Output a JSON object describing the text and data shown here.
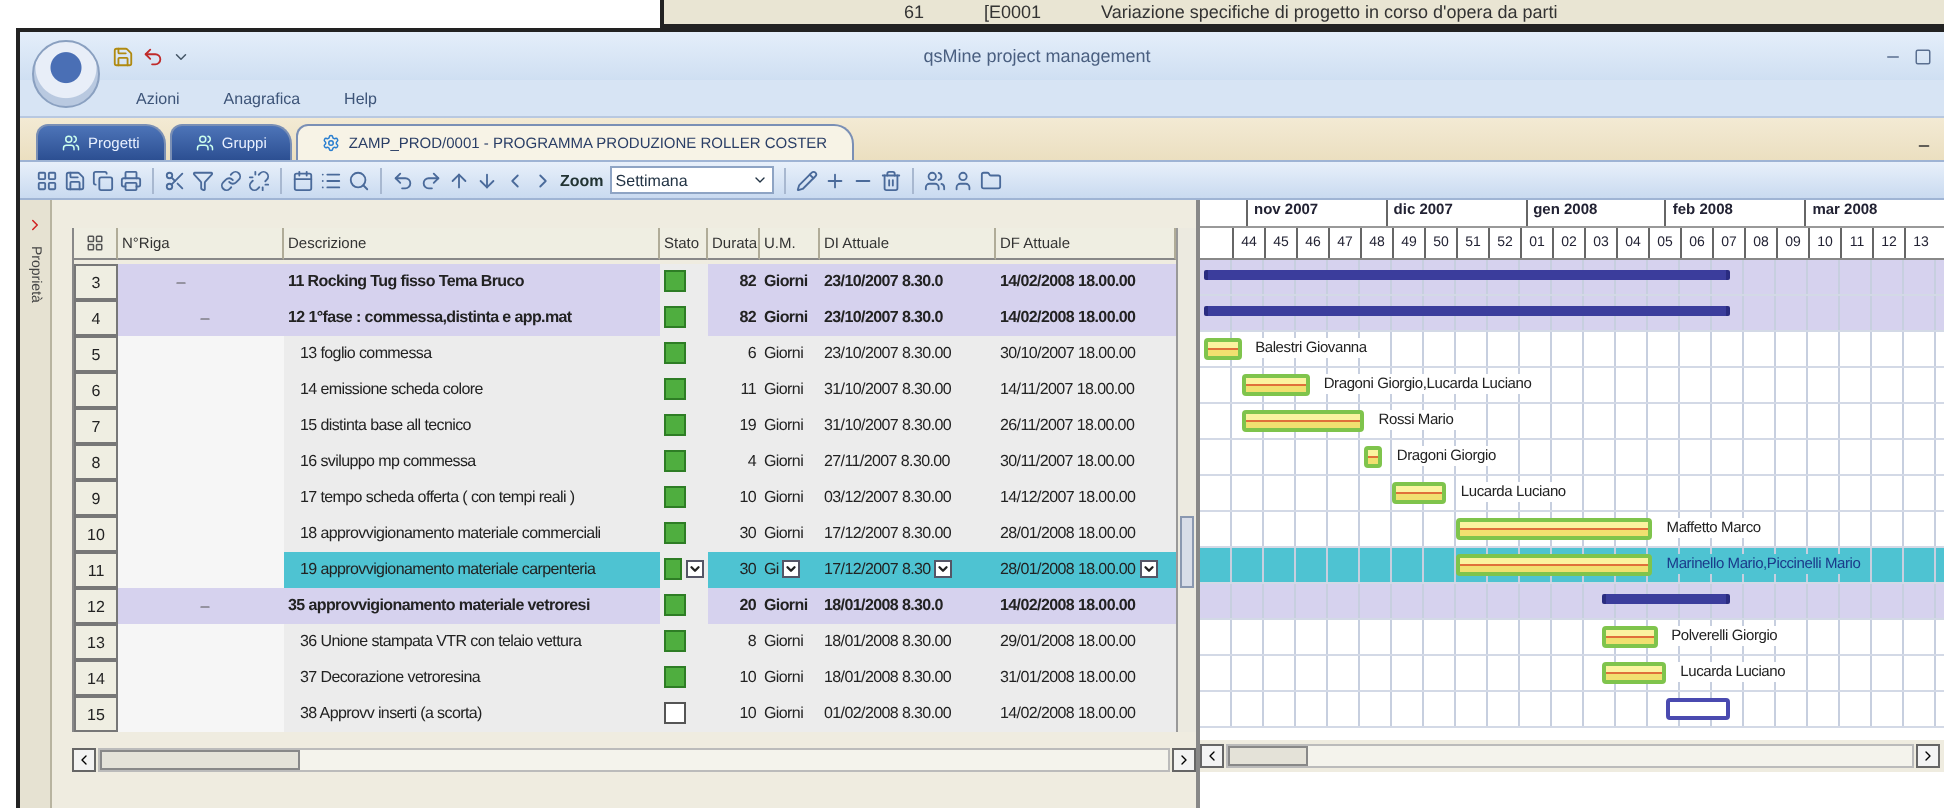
{
  "background_note": {
    "number": "61",
    "code": "[E0001",
    "text": "Variazione specifiche di progetto in corso d'opera da parti"
  },
  "window": {
    "title": "qsMine project management"
  },
  "menu": [
    "Azioni",
    "Anagrafica",
    "Help"
  ],
  "tabs": [
    {
      "label": "Progetti",
      "selected": false
    },
    {
      "label": "Gruppi",
      "selected": false
    },
    {
      "label": "ZAMP_PROD/0001 - PROGRAMMA PRODUZIONE ROLLER COSTER",
      "selected": true
    }
  ],
  "toolbar": {
    "zoom_label": "Zoom",
    "zoom_value": "Settimana"
  },
  "side_panel": {
    "label": "Proprietà"
  },
  "table": {
    "columns": [
      "N°Riga",
      "Descrizione",
      "Stato",
      "Durata",
      "U.M.",
      "DI Attuale",
      "DF Attuale"
    ],
    "rows": [
      {
        "number": "3",
        "kind": "summary",
        "expanded": true,
        "description": "11 Rocking Tug fisso Tema Bruco",
        "done": true,
        "duration": "82",
        "unit": "Giorni",
        "start": "23/10/2007 8.30.0",
        "end": "14/02/2008 18.00.00",
        "selected": false,
        "children": [
          {
            "number": "4",
            "kind": "summary",
            "expanded": true,
            "description": "12 1°fase : commessa,distinta e app.mat",
            "done": true,
            "duration": "82",
            "unit": "Giorni",
            "start": "23/10/2007 8.30.0",
            "end": "14/02/2008 18.00.00",
            "selected": false,
            "children": [
              {
                "number": "5",
                "kind": "task",
                "description": "13 foglio commessa",
                "done": true,
                "duration": "6",
                "unit": "Giorni",
                "start": "23/10/2007 8.30.00",
                "end": "30/10/2007 18.00.00",
                "selected": false,
                "resource": "Balestri Giovanna"
              },
              {
                "number": "6",
                "kind": "task",
                "description": "14 emissione scheda colore",
                "done": true,
                "duration": "11",
                "unit": "Giorni",
                "start": "31/10/2007 8.30.00",
                "end": "14/11/2007 18.00.00",
                "selected": false,
                "resource": "Dragoni Giorgio,Lucarda Luciano"
              },
              {
                "number": "7",
                "kind": "task",
                "description": "15 distinta base all tecnico",
                "done": true,
                "duration": "19",
                "unit": "Giorni",
                "start": "31/10/2007 8.30.00",
                "end": "26/11/2007 18.00.00",
                "selected": false,
                "resource": "Rossi Mario"
              },
              {
                "number": "8",
                "kind": "task",
                "description": "16 sviluppo mp commessa",
                "done": true,
                "duration": "4",
                "unit": "Giorni",
                "start": "27/11/2007 8.30.00",
                "end": "30/11/2007 18.00.00",
                "selected": false,
                "resource": "Dragoni Giorgio"
              },
              {
                "number": "9",
                "kind": "task",
                "description": "17 tempo scheda offerta ( con tempi reali )",
                "done": true,
                "duration": "10",
                "unit": "Giorni",
                "start": "03/12/2007 8.30.00",
                "end": "14/12/2007 18.00.00",
                "selected": false,
                "resource": "Lucarda Luciano"
              },
              {
                "number": "10",
                "kind": "task",
                "description": "18 approvvigionamento materiale commerciali",
                "done": true,
                "duration": "30",
                "unit": "Giorni",
                "start": "17/12/2007 8.30.00",
                "end": "28/01/2008 18.00.00",
                "selected": false,
                "resource": "Maffetto Marco"
              },
              {
                "number": "11",
                "kind": "task",
                "description": "19 approvvigionamento materiale carpenteria",
                "done": true,
                "duration": "30",
                "unit": "Gi",
                "start": "17/12/2007 8.30",
                "end": "28/01/2008 18.00.00",
                "selected": true,
                "resource": "Marinello Mario,Piccinelli Mario"
              }
            ]
          },
          {
            "number": "12",
            "kind": "summary",
            "expanded": true,
            "description": "35 approvvigionamento materiale vetroresi",
            "done": true,
            "duration": "20",
            "unit": "Giorni",
            "start": "18/01/2008 8.30.0",
            "end": "14/02/2008 18.00.00",
            "selected": false,
            "children": [
              {
                "number": "13",
                "kind": "task",
                "description": "36 Unione stampata VTR con telaio vettura",
                "done": true,
                "duration": "8",
                "unit": "Giorni",
                "start": "18/01/2008 8.30.00",
                "end": "29/01/2008 18.00.00",
                "selected": false,
                "resource": "Polverelli Giorgio"
              },
              {
                "number": "14",
                "kind": "task",
                "description": "37 Decorazione vetroresina",
                "done": true,
                "duration": "10",
                "unit": "Giorni",
                "start": "18/01/2008 8.30.00",
                "end": "31/01/2008 18.00.00",
                "selected": false,
                "resource": "Lucarda Luciano"
              },
              {
                "number": "15",
                "kind": "task",
                "description": "38 Approvv inserti (a scorta)",
                "done": false,
                "duration": "10",
                "unit": "Giorni",
                "start": "01/02/2008 8.30.00",
                "end": "14/02/2008 18.00.00",
                "selected": false
              }
            ]
          }
        ]
      }
    ]
  },
  "gantt": {
    "months": [
      "nov 2007",
      "dic 2007",
      "gen 2008",
      "feb 2008",
      "mar 2008"
    ],
    "weeks": [
      "44",
      "45",
      "46",
      "47",
      "48",
      "49",
      "50",
      "51",
      "52",
      "01",
      "02",
      "03",
      "04",
      "05",
      "06",
      "07",
      "08",
      "09",
      "10",
      "11",
      "12",
      "13"
    ]
  }
}
